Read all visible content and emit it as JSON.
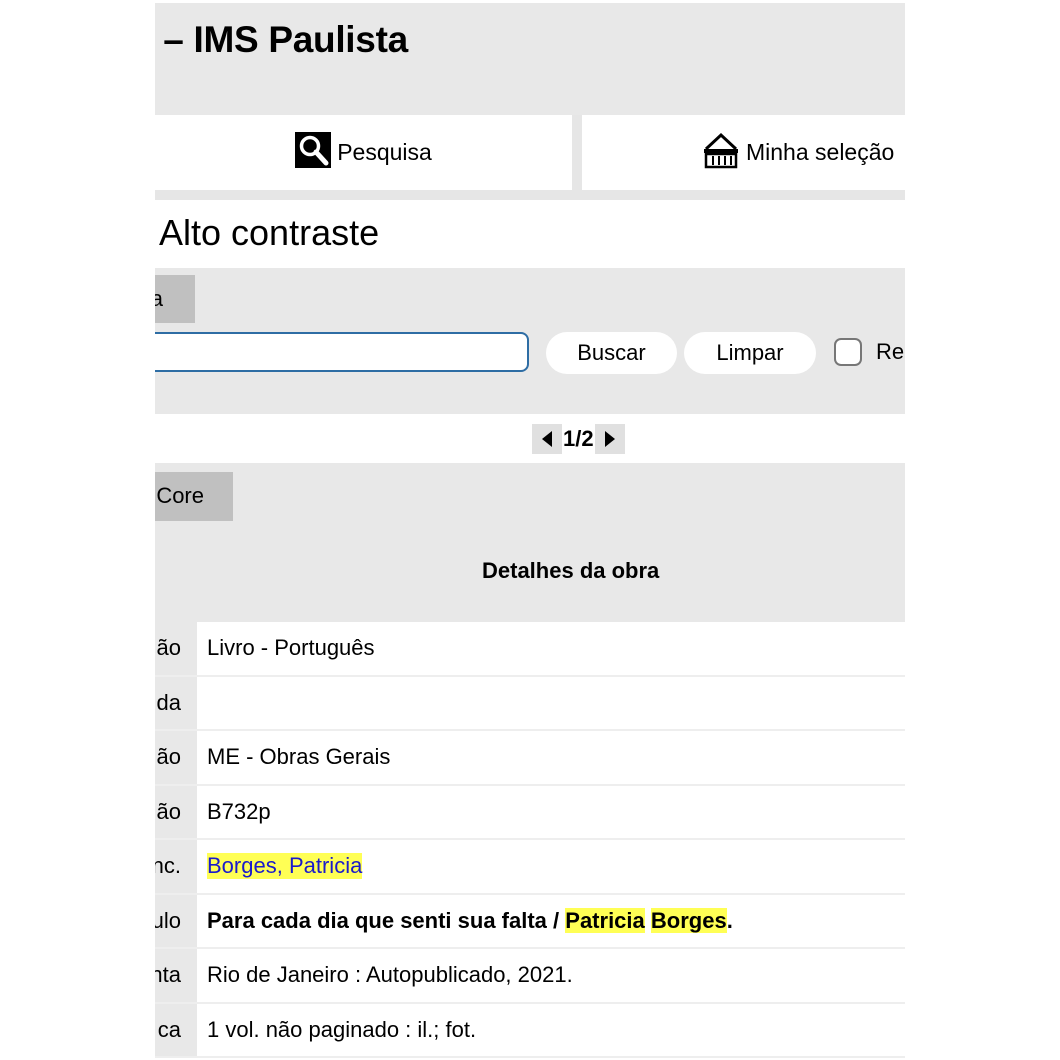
{
  "header": {
    "title": "a – IMS Paulista"
  },
  "nav": {
    "pesquisa_label": "Pesquisa",
    "selecao_label": "Minha seleção"
  },
  "accessibility": {
    "contrast_label": "Alto contraste"
  },
  "search": {
    "tab_label": "a",
    "input_value": "",
    "buscar_label": "Buscar",
    "limpar_label": "Limpar",
    "checkbox_label": "Re",
    "checkbox_checked": false
  },
  "pager": {
    "text": "1/2"
  },
  "results": {
    "tab_label": "Core",
    "details_title": "Detalhes da obra"
  },
  "detail_rows": [
    {
      "label": "ão",
      "value": "Livro - Português"
    },
    {
      "label": "da",
      "value": ""
    },
    {
      "label": "ão",
      "value": "ME - Obras Gerais"
    },
    {
      "label": "ão",
      "value": "B732p"
    },
    {
      "label": "nc.",
      "author_last": "Borges",
      "sep": ", ",
      "author_first": "Patricia"
    },
    {
      "label": "ulo",
      "title_text": "Para cada dia que senti sua falta / ",
      "hl1": "Patricia",
      "space": " ",
      "hl2": "Borges",
      "end": "."
    },
    {
      "label": "nta",
      "value": "Rio de Janeiro : Autopublicado, 2021."
    },
    {
      "label": "ca",
      "value": "1 vol. não paginado : il.; fot."
    }
  ],
  "colors": {
    "highlight": "#ffff55",
    "link": "#1a1acc",
    "input_border": "#2e6da4",
    "panel": "#e8e8e8"
  }
}
